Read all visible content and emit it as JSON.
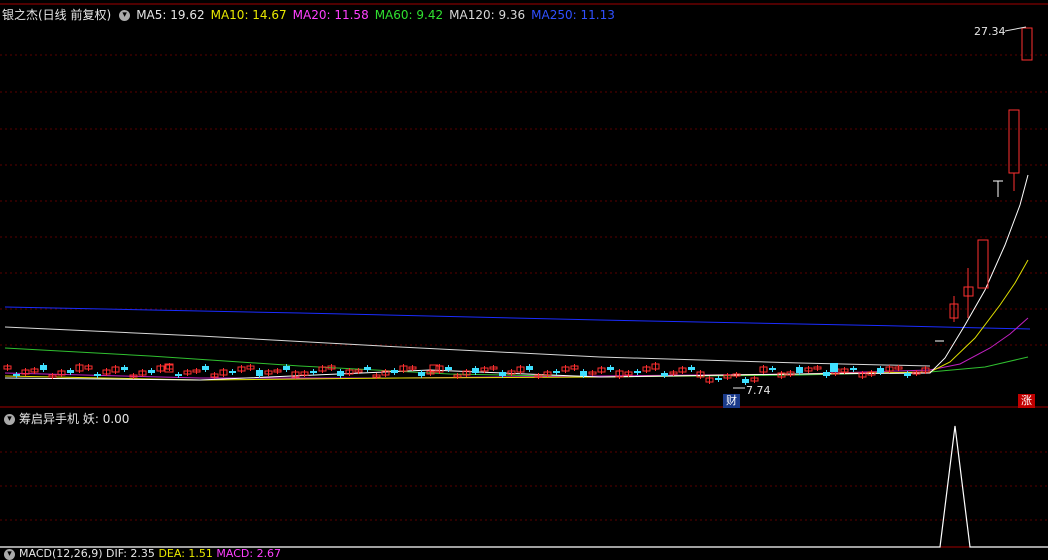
{
  "main_panel": {
    "title": "银之杰(日线 前复权)",
    "mas": [
      {
        "label": "MA5: 19.62",
        "color": "#e6e6e6"
      },
      {
        "label": "MA10: 14.67",
        "color": "#e8e800"
      },
      {
        "label": "MA20: 11.58",
        "color": "#ff40ff"
      },
      {
        "label": "MA60: 9.42",
        "color": "#30e030"
      },
      {
        "label": "MA120: 9.36",
        "color": "#d8d8d8"
      },
      {
        "label": "MA250: 11.13",
        "color": "#3050ff"
      }
    ],
    "high_label": "27.34",
    "low_label": "7.74",
    "badge_cai": "财",
    "badge_zhang": "涨"
  },
  "sub_panel": {
    "title": "筹启异手机",
    "indicator": "妖: 0.00"
  },
  "bottom_panel": {
    "title": "MACD(12,26,9)",
    "dif": "DIF: 2.35",
    "dea": "DEA: 1.51",
    "macd": "MACD: 2.67"
  },
  "colors": {
    "up": "#ff3030",
    "down": "#40e0ff",
    "grid": "#5a0000",
    "border": "#a00000",
    "ma250": "#1a2cff",
    "ma120": "#d8d8d8",
    "ma60": "#30c030",
    "ma20": "#c020c0",
    "ma10": "#e0e000",
    "ma5": "#ffffff"
  }
}
